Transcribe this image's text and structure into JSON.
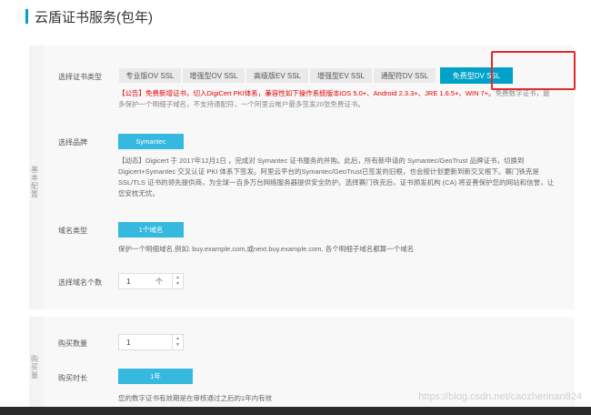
{
  "page": {
    "title": "云盾证书服务(包年)"
  },
  "section_basic": {
    "side_label": "基本配置",
    "cert_type": {
      "label": "选择证书类型",
      "options": [
        "专业版OV SSL",
        "增强型OV SSL",
        "高级版EV SSL",
        "增强型EV SSL",
        "通配符DV SSL",
        "免费型DV SSL"
      ],
      "selected": "免费型DV SSL"
    },
    "notice": {
      "red": "【公告】免费新增证书，切入DigiCert PKI体系，兼容性如下操作系统版本iOS 5.0+、Android 2.3.3+、JRE 1.6.5+、WIN 7+。",
      "gray": "免费数字证书，最多保护一个明细子域名，不支持通配符，一个阿里云帐户最多签发20张免费证书。"
    },
    "brand": {
      "label": "选择品牌",
      "value": "Symantec",
      "desc": "【动态】Digicert 于 2017年12月1日 ，完成对 Symantec 证书服务的并购。此后，所有新申请的 Symantec/GeoTrust 品牌证书，切换到 Digicert+Symantec 交叉认证 PKI 体系下签发。阿里云平台的Symantec/GeoTrust已签发的旧根，也会按计划更新到新交叉根下。赛门铁克是 SSL/TLS 证书的领先提供商，为全球一百多万台网络服务器提供安全防护。选择赛门铁克后，证书颁发机构 (CA) 将妥善保护您的网站和信誉，让您安枕无忧。"
    },
    "domain_type": {
      "label": "域名类型",
      "value": "1个域名",
      "desc": "保护一个明细域名,例如: buy.example.com,或next.buy.example.com, 各个明细子域名都算一个域名"
    },
    "domain_count": {
      "label": "选择域名个数",
      "value": "1",
      "unit": "个"
    }
  },
  "section_purchase": {
    "side_label": "购买量",
    "quantity": {
      "label": "购买数量",
      "value": "1"
    },
    "duration": {
      "label": "购买时长",
      "value": "1年",
      "desc": "您的数字证书有效期是在审核通过之后的1年内有效"
    }
  },
  "watermark": "https://blog.csdn.net/caozhennan824"
}
